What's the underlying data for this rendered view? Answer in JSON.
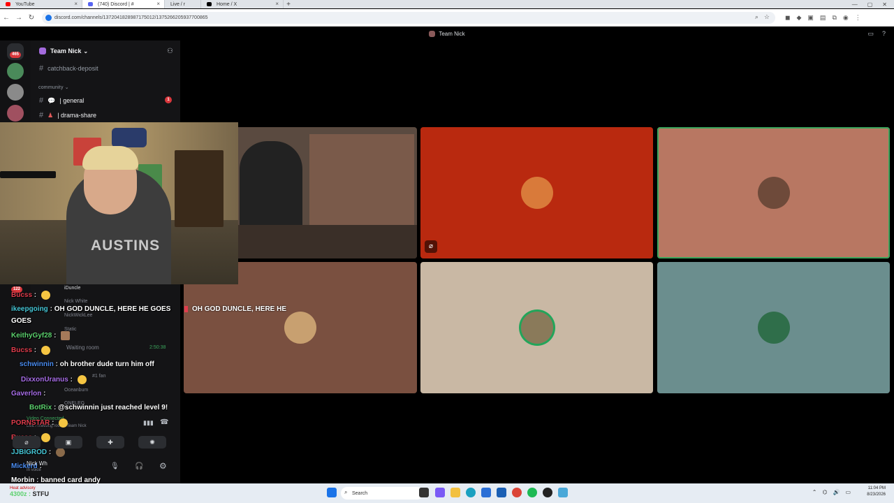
{
  "browser": {
    "tabs": [
      {
        "label": "YouTube",
        "color": "#ff0000"
      },
      {
        "label": "(740) Discord | #",
        "color": "#5865f2"
      },
      {
        "label": "Live / r",
        "color": "#e53935"
      },
      {
        "label": "Home / X",
        "color": "#000000"
      }
    ],
    "url": "discord.com/channels/1372041828987175012/1375266205937700865"
  },
  "discord": {
    "window_title": "Team Nick",
    "guild_badge": "465",
    "server_name": "Team Nick",
    "channels": {
      "top": "catchback-deposit",
      "category": "community",
      "general": "general",
      "general_badge": "1",
      "drama": "drama-share"
    },
    "voice_members": [
      "iDuncle",
      "Nick White",
      "NickWickLee",
      "Static",
      "Oceanbum",
      "ONELEG"
    ],
    "voice_badge": "122",
    "waiting_room": "Waiting room",
    "waiting_time": "2:50:38",
    "nick_fan": "#1 fan",
    "voice_connected": "Video Connected",
    "voice_location": "Live / meeting room / Team Nick",
    "user_name": "Nick Wh",
    "user_status": "In voice"
  },
  "chat": [
    {
      "user": "Bucss",
      "color": "#e03d4d",
      "text": "",
      "emoji": true
    },
    {
      "user": "ikeepgoing",
      "color": "#46c6d6",
      "text": "OH GOD DUNCLE, HERE HE GOES"
    },
    {
      "user": "",
      "color": "#ffffff",
      "text": "GOES"
    },
    {
      "user": "KeithyGyf28",
      "color": "#5cd16e",
      "text": "",
      "emoji": true
    },
    {
      "user": "Bucss",
      "color": "#e03d4d",
      "text": "",
      "emoji": true
    },
    {
      "user": "schwinnin",
      "color": "#4a8cf0",
      "text": "oh brother dude turn him off"
    },
    {
      "user": "DixxonUranus",
      "color": "#a86ee8",
      "text": "",
      "emoji": true
    },
    {
      "user": "Gaverlon",
      "color": "#a86ee8",
      "text": ""
    },
    {
      "user": "BotRix",
      "color": "#5cd16e",
      "text": "@schwinnin just reached level 9!"
    },
    {
      "user": "PORNSTAR",
      "color": "#e03d4d",
      "text": "",
      "emoji": true
    },
    {
      "user": "Bucss",
      "color": "#e03d4d",
      "text": "",
      "emoji": true
    },
    {
      "user": "JJBIGROD",
      "color": "#46c6d6",
      "text": "",
      "emoji": true
    },
    {
      "user": "Mickerd",
      "color": "#4a8cf0",
      "text": ""
    },
    {
      "user": "Morbin",
      "color": "#ffffff",
      "text": "banned card andy"
    },
    {
      "user": "4300z",
      "color": "#5cd16e",
      "text": "STFU"
    }
  ],
  "overlay_text": "OH GOD DUNCLE, HERE HE",
  "stage": {
    "tiles": [
      {
        "kind": "video",
        "bg": "#5a4a40"
      },
      {
        "kind": "avatar",
        "bg": "#b9290f",
        "avatar": "#d97a3a"
      },
      {
        "kind": "avatar",
        "bg": "#b87762",
        "avatar": "#6e4a3a"
      },
      {
        "kind": "avatar",
        "bg": "#7a5040",
        "avatar": "#c8a070"
      },
      {
        "kind": "avatar",
        "bg": "#c9b8a4",
        "avatar": "#8a7a5a"
      },
      {
        "kind": "avatar",
        "bg": "#6b8e8e",
        "avatar": "#2f6e4a"
      }
    ]
  },
  "webcam": {
    "shirt_text": "AUSTINS"
  },
  "taskbar": {
    "weather_title": "Heat advisory",
    "search": "Search",
    "time": "11:04 PM",
    "date": "8/23/2026"
  }
}
